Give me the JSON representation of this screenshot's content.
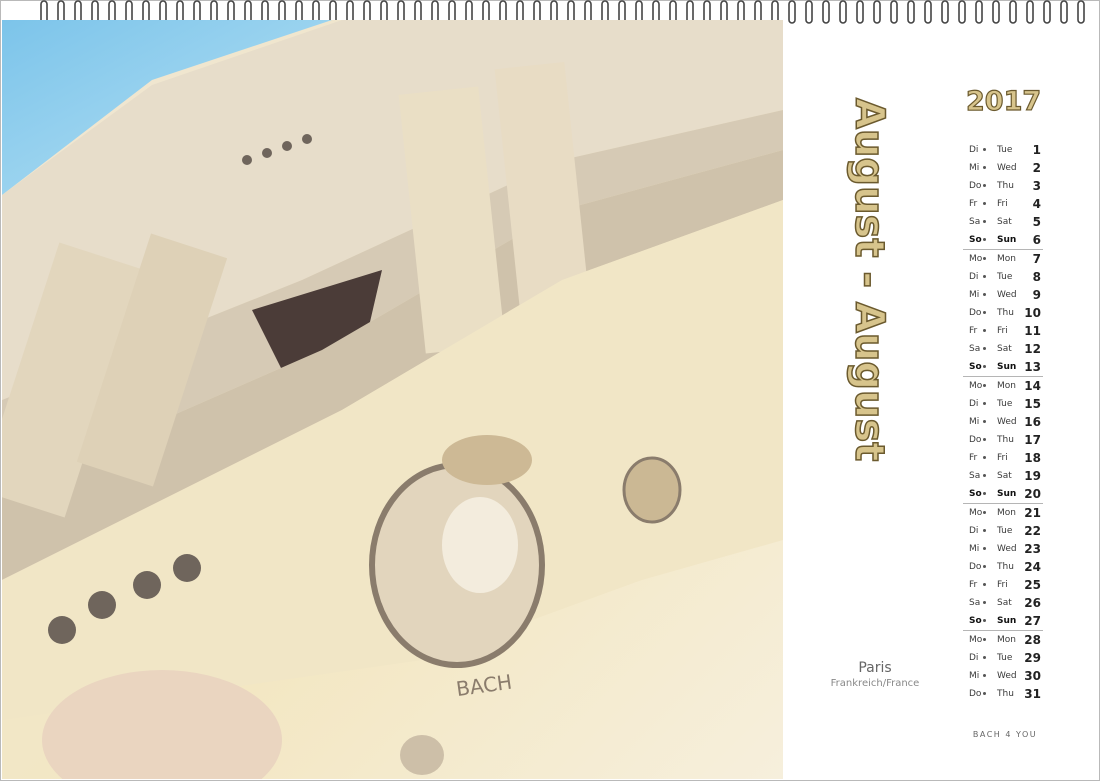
{
  "calendar": {
    "year": "2017",
    "month_title": "August - August",
    "location": {
      "city": "Paris",
      "country": "Frankreich/France"
    },
    "brand": "BACH 4 YOU",
    "painting": {
      "icon": "watercolor-painting-facade",
      "inscription": "BACH"
    },
    "days": [
      {
        "de": "Di",
        "en": "Tue",
        "num": "1",
        "weekend": false
      },
      {
        "de": "Mi",
        "en": "Wed",
        "num": "2",
        "weekend": false
      },
      {
        "de": "Do",
        "en": "Thu",
        "num": "3",
        "weekend": false
      },
      {
        "de": "Fr",
        "en": "Fri",
        "num": "4",
        "weekend": false
      },
      {
        "de": "Sa",
        "en": "Sat",
        "num": "5",
        "weekend": false
      },
      {
        "de": "So",
        "en": "Sun",
        "num": "6",
        "weekend": true
      },
      {
        "de": "Mo",
        "en": "Mon",
        "num": "7",
        "weekend": false
      },
      {
        "de": "Di",
        "en": "Tue",
        "num": "8",
        "weekend": false
      },
      {
        "de": "Mi",
        "en": "Wed",
        "num": "9",
        "weekend": false
      },
      {
        "de": "Do",
        "en": "Thu",
        "num": "10",
        "weekend": false
      },
      {
        "de": "Fr",
        "en": "Fri",
        "num": "11",
        "weekend": false
      },
      {
        "de": "Sa",
        "en": "Sat",
        "num": "12",
        "weekend": false
      },
      {
        "de": "So",
        "en": "Sun",
        "num": "13",
        "weekend": true
      },
      {
        "de": "Mo",
        "en": "Mon",
        "num": "14",
        "weekend": false
      },
      {
        "de": "Di",
        "en": "Tue",
        "num": "15",
        "weekend": false
      },
      {
        "de": "Mi",
        "en": "Wed",
        "num": "16",
        "weekend": false
      },
      {
        "de": "Do",
        "en": "Thu",
        "num": "17",
        "weekend": false
      },
      {
        "de": "Fr",
        "en": "Fri",
        "num": "18",
        "weekend": false
      },
      {
        "de": "Sa",
        "en": "Sat",
        "num": "19",
        "weekend": false
      },
      {
        "de": "So",
        "en": "Sun",
        "num": "20",
        "weekend": true
      },
      {
        "de": "Mo",
        "en": "Mon",
        "num": "21",
        "weekend": false
      },
      {
        "de": "Di",
        "en": "Tue",
        "num": "22",
        "weekend": false
      },
      {
        "de": "Mi",
        "en": "Wed",
        "num": "23",
        "weekend": false
      },
      {
        "de": "Do",
        "en": "Thu",
        "num": "24",
        "weekend": false
      },
      {
        "de": "Fr",
        "en": "Fri",
        "num": "25",
        "weekend": false
      },
      {
        "de": "Sa",
        "en": "Sat",
        "num": "26",
        "weekend": false
      },
      {
        "de": "So",
        "en": "Sun",
        "num": "27",
        "weekend": true
      },
      {
        "de": "Mo",
        "en": "Mon",
        "num": "28",
        "weekend": false
      },
      {
        "de": "Di",
        "en": "Tue",
        "num": "29",
        "weekend": false
      },
      {
        "de": "Mi",
        "en": "Wed",
        "num": "30",
        "weekend": false
      },
      {
        "de": "Do",
        "en": "Thu",
        "num": "31",
        "weekend": false
      }
    ]
  },
  "colors": {
    "gold_fill": "#d7c48c",
    "gold_outline": "#6b5a2e",
    "sky": "#8fd0ee",
    "stone": "#ece4d2",
    "shadow": "#8a7c6c"
  }
}
